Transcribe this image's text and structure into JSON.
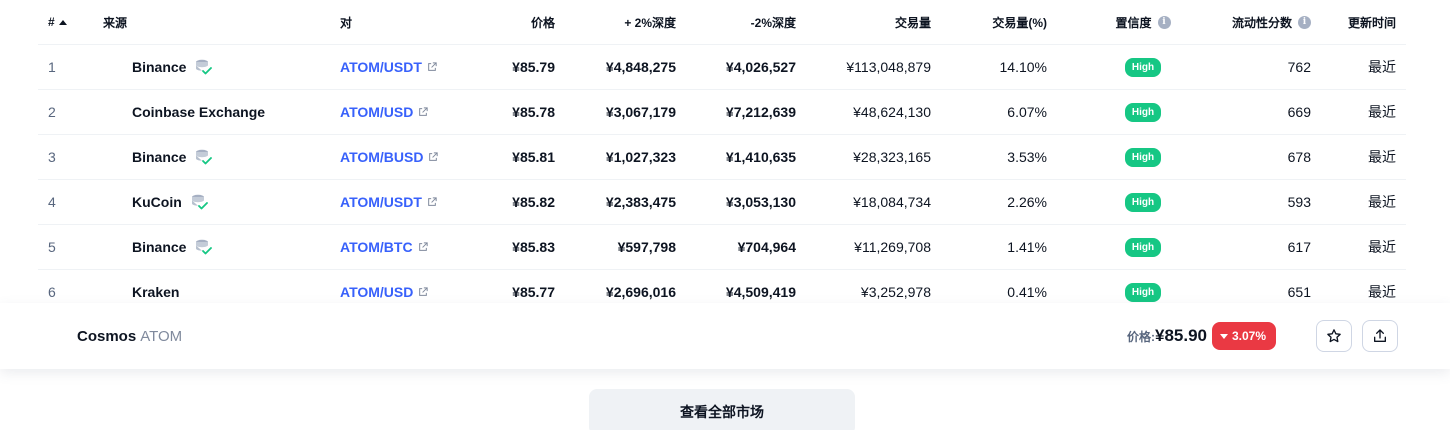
{
  "header": {
    "num": "#",
    "source": "来源",
    "pair": "对",
    "price": "价格",
    "plus_depth": "+ 2%深度",
    "minus_depth": "-2%深度",
    "volume": "交易量",
    "volume_pct": "交易量(%)",
    "confidence": "置信度",
    "liquidity": "流动性分数",
    "updated": "更新时间"
  },
  "rows": [
    {
      "num": "1",
      "source": "Binance",
      "verified": true,
      "pair": "ATOM/USDT",
      "price": "¥85.79",
      "plus_depth": "¥4,848,275",
      "minus_depth": "¥4,026,527",
      "volume": "¥113,048,879",
      "volume_pct": "14.10%",
      "confidence": "High",
      "liquidity": "762",
      "updated": "最近"
    },
    {
      "num": "2",
      "source": "Coinbase Exchange",
      "verified": false,
      "pair": "ATOM/USD",
      "price": "¥85.78",
      "plus_depth": "¥3,067,179",
      "minus_depth": "¥7,212,639",
      "volume": "¥48,624,130",
      "volume_pct": "6.07%",
      "confidence": "High",
      "liquidity": "669",
      "updated": "最近"
    },
    {
      "num": "3",
      "source": "Binance",
      "verified": true,
      "pair": "ATOM/BUSD",
      "price": "¥85.81",
      "plus_depth": "¥1,027,323",
      "minus_depth": "¥1,410,635",
      "volume": "¥28,323,165",
      "volume_pct": "3.53%",
      "confidence": "High",
      "liquidity": "678",
      "updated": "最近"
    },
    {
      "num": "4",
      "source": "KuCoin",
      "verified": true,
      "pair": "ATOM/USDT",
      "price": "¥85.82",
      "plus_depth": "¥2,383,475",
      "minus_depth": "¥3,053,130",
      "volume": "¥18,084,734",
      "volume_pct": "2.26%",
      "confidence": "High",
      "liquidity": "593",
      "updated": "最近"
    },
    {
      "num": "5",
      "source": "Binance",
      "verified": true,
      "pair": "ATOM/BTC",
      "price": "¥85.83",
      "plus_depth": "¥597,798",
      "minus_depth": "¥704,964",
      "volume": "¥11,269,708",
      "volume_pct": "1.41%",
      "confidence": "High",
      "liquidity": "617",
      "updated": "最近"
    },
    {
      "num": "6",
      "source": "Kraken",
      "verified": false,
      "pair": "ATOM/USD",
      "price": "¥85.77",
      "plus_depth": "¥2,696,016",
      "minus_depth": "¥4,509,419",
      "volume": "¥3,252,978",
      "volume_pct": "0.41%",
      "confidence": "High",
      "liquidity": "651",
      "updated": "最近"
    }
  ],
  "sticky": {
    "coin_name": "Cosmos",
    "coin_symbol": "ATOM",
    "price_label": "价格:",
    "price": "¥85.90",
    "change": "3.07%",
    "change_direction": "down"
  },
  "view_all_label": "查看全部市场",
  "colors": {
    "link": "#3861fb",
    "high_badge": "#16c784",
    "change_down": "#ea3943",
    "verified_icon": "#16c784"
  }
}
